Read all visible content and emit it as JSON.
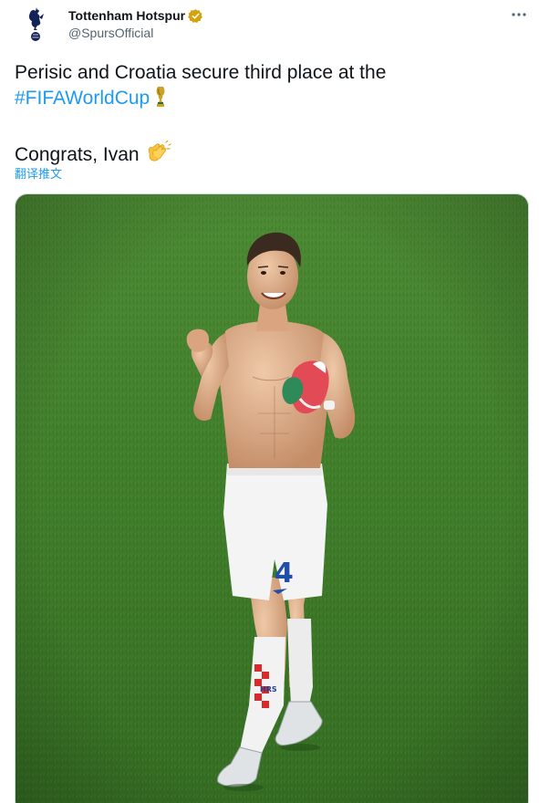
{
  "account": {
    "display_name": "Tottenham Hotspur",
    "handle": "@SpursOfficial",
    "verified": true,
    "verified_color": "#d4a20a"
  },
  "tweet": {
    "line1": "Perisic and Croatia secure third place at the",
    "hashtag": "#FIFAWorldCup",
    "line3": "Congrats, Ivan",
    "translate_label": "翻译推文"
  },
  "media": {
    "shirt_number": "4",
    "sock_text": "HRS"
  },
  "colors": {
    "link": "#1d9bf0",
    "text": "#0f1419",
    "secondary": "#536471",
    "pitch": "#3e7a27"
  },
  "icons": {
    "avatar": "cockerel-crest-icon",
    "verified": "verified-badge-icon",
    "more": "more-options-icon",
    "trophy": "trophy-emoji-icon",
    "clap": "clapping-hands-emoji-icon"
  }
}
